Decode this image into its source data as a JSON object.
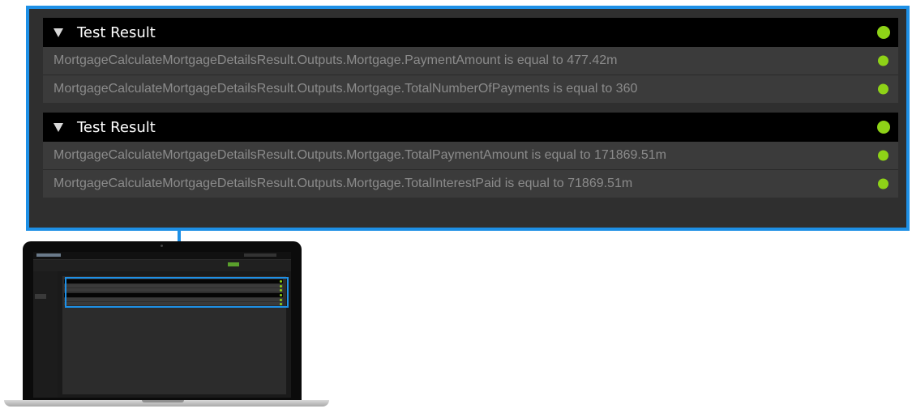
{
  "colors": {
    "accent_blue": "#1e90e6",
    "pass_green": "#8ed217",
    "header_bg": "#000000",
    "row_bg": "#3b3b3b",
    "row_text": "#8b8b8b"
  },
  "status_icon": "green-status-dot-icon",
  "expand_icon": "triangle-down-icon",
  "groups": [
    {
      "title": "Test Result",
      "status": "pass",
      "results": [
        {
          "text": "MortgageCalculateMortgageDetailsResult.Outputs.Mortgage.PaymentAmount is equal to 477.42m",
          "status": "pass"
        },
        {
          "text": "MortgageCalculateMortgageDetailsResult.Outputs.Mortgage.TotalNumberOfPayments is equal to 360",
          "status": "pass"
        }
      ]
    },
    {
      "title": "Test Result",
      "status": "pass",
      "results": [
        {
          "text": "MortgageCalculateMortgageDetailsResult.Outputs.Mortgage.TotalPaymentAmount is equal to 171869.51m",
          "status": "pass"
        },
        {
          "text": "MortgageCalculateMortgageDetailsResult.Outputs.Mortgage.TotalInterestPaid is equal to 71869.51m",
          "status": "pass"
        }
      ]
    }
  ]
}
